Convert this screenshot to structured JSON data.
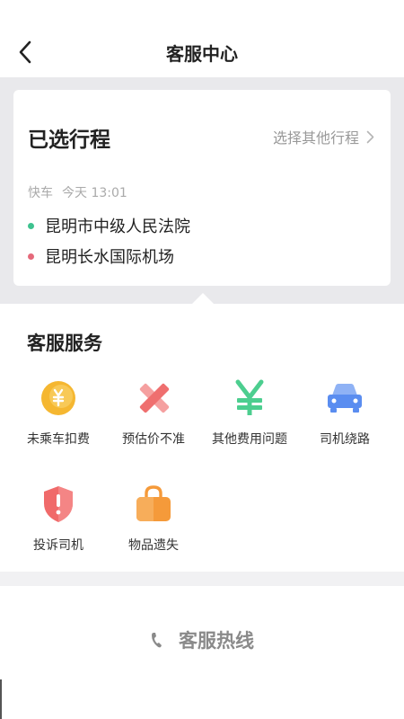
{
  "header": {
    "title": "客服中心",
    "back_icon": "chevron-left-icon"
  },
  "trip": {
    "title": "已选行程",
    "other_label": "选择其他行程",
    "service_type": "快车",
    "time": "今天 13:01",
    "origin": "昆明市中级人民法院",
    "destination": "昆明长水国际机场",
    "origin_color": "#3ec28f",
    "destination_color": "#e5697a"
  },
  "services": {
    "title": "客服服务",
    "items": [
      {
        "label": "未乘车扣费",
        "icon": "yen-coin-icon",
        "color": "#f5b731"
      },
      {
        "label": "预估价不准",
        "icon": "cross-icon",
        "color": "#f07a7a"
      },
      {
        "label": "其他费用问题",
        "icon": "yen-icon",
        "color": "#4cce8f"
      },
      {
        "label": "司机绕路",
        "icon": "car-icon",
        "color": "#5a8df0"
      },
      {
        "label": "投诉司机",
        "icon": "shield-alert-icon",
        "color": "#f06a6a"
      },
      {
        "label": "物品遗失",
        "icon": "bag-icon",
        "color": "#f59a3a"
      }
    ]
  },
  "hotline": {
    "label": "客服热线",
    "icon": "phone-icon"
  }
}
